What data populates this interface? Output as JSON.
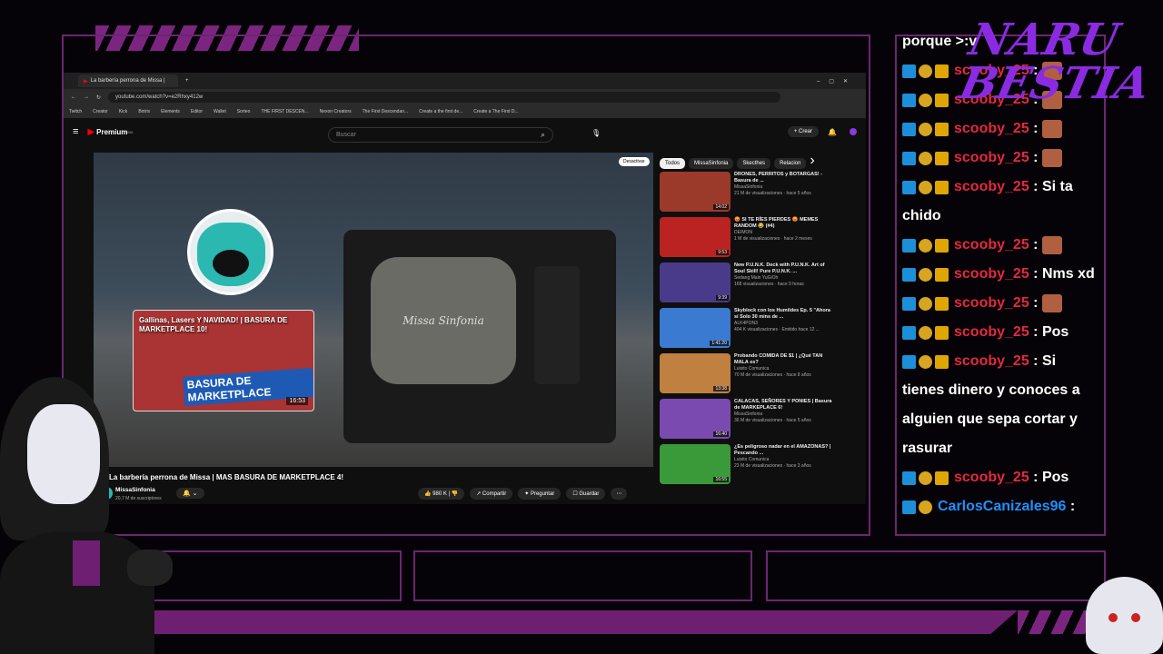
{
  "browser": {
    "tab_title": "La barbería perrona de Missa |",
    "url": "youtube.com/watch?v=e2Rhxy412w",
    "bookmarks": [
      "Twitch",
      "Creator",
      "Kick",
      "Botrix",
      "Elements",
      "Editor",
      "Wallet",
      "Sorteo",
      "THE FIRST DESCEN...",
      "Nexon Creators",
      "The First Descendan...",
      "Create a the first de...",
      "Create a The First D..."
    ]
  },
  "youtube": {
    "brand": "Premium",
    "brand_sup": "MX",
    "search_placeholder": "Buscar",
    "create_label": "+ Crear",
    "video_title": "La barbería perrona de Missa | MAS BASURA DE MARKETPLACE 4!",
    "channel_name": "MissaSinfonia",
    "subscribers": "20,7 M de suscriptores",
    "likes": "980 K",
    "share_label": "Compartir",
    "ask_label": "Preguntar",
    "save_label": "Guardar",
    "ambient_label": "Desactivar",
    "tv_text": "Missa Sinfonia",
    "endcard_title": "Gallinas, Lasers Y NAVIDAD! | BASURA DE MARKETPLACE 10!",
    "endcard_banner": "BASURA DE MARKETPLACE",
    "endcard_duration": "16:53",
    "chips": [
      "Todos",
      "MissaSinfonia",
      "Skecthes",
      "Relacion"
    ],
    "recommendations": [
      {
        "title": "DRONES, PERRITOS y BOTARGAS! - Basura de ...",
        "channel": "MissaSinfonia",
        "meta": "21 M de visualizaciones · hace 5 años",
        "duration": "14:02",
        "color": "#9b3a2a"
      },
      {
        "title": "😡 SI TE RÍES PIERDES 😡 MEMES RANDOM 😂 (#4)",
        "channel": "DEIMON",
        "meta": "1 M de visualizaciones · hace 2 meses",
        "duration": "9:53",
        "color": "#b22"
      },
      {
        "title": "New P.U.N.K. Deck with P.U.N.K. Art of Soul Skill! Pure P.U.N.K. ...",
        "channel": "Sedang Main YuGiOh",
        "meta": "168 visualizaciones · hace 9 horas",
        "duration": "9:39",
        "color": "#4a3a8a"
      },
      {
        "title": "Skyblock con los Humildes Ep. 5 \"Ahora sí Solo 30 mins de ...",
        "channel": "ALK4PON3",
        "meta": "404 K visualizaciones · Emitido hace 12 ...",
        "duration": "1:41:20",
        "color": "#3a7ad0"
      },
      {
        "title": "Probando COMIDA DE $1 | ¿Qué TAN MALA es?",
        "channel": "Luisito Comunica",
        "meta": "70 M de visualizaciones · hace 8 años",
        "duration": "13:38",
        "color": "#c08040"
      },
      {
        "title": "CALACAS, SEÑORES Y PONIES | Basura de MARKEPLACE 6!",
        "channel": "MissaSinfonia",
        "meta": "36 M de visualizaciones · hace 5 años",
        "duration": "16:40",
        "color": "#7a4ab0"
      },
      {
        "title": "¿Es peligroso nadar en el AMAZONAS? | Pescando ...",
        "channel": "Luisito Comunica",
        "meta": "23 M de visualizaciones · hace 3 años",
        "duration": "16:55",
        "color": "#3a9a3a"
      }
    ]
  },
  "chat": {
    "lines": [
      {
        "user": "",
        "text": "porque >:v",
        "badges": 0
      },
      {
        "user": "scooby_25",
        "text": ":",
        "badges": 3,
        "emote": true
      },
      {
        "user": "scooby_25",
        "text": ":",
        "badges": 3,
        "emote": true
      },
      {
        "user": "scooby_25",
        "text": ":",
        "badges": 3,
        "emote": true
      },
      {
        "user": "scooby_25",
        "text": ":",
        "badges": 3,
        "emote": true
      },
      {
        "user": "scooby_25",
        "text": ": Si ta",
        "badges": 3
      },
      {
        "user": "",
        "text": "chido",
        "badges": 0
      },
      {
        "user": "scooby_25",
        "text": ":",
        "badges": 3,
        "emote": true
      },
      {
        "user": "scooby_25",
        "text": ": Nms xd",
        "badges": 3
      },
      {
        "user": "scooby_25",
        "text": ":",
        "badges": 3,
        "emote": true
      },
      {
        "user": "scooby_25",
        "text": ": Pos",
        "badges": 3
      },
      {
        "user": "scooby_25",
        "text": ": Si",
        "badges": 3
      },
      {
        "user": "",
        "text": "tienes dinero y conoces a",
        "badges": 0
      },
      {
        "user": "",
        "text": "alguien que sepa cortar y",
        "badges": 0
      },
      {
        "user": "",
        "text": "rasurar",
        "badges": 0
      },
      {
        "user": "scooby_25",
        "text": ": Pos",
        "badges": 3
      },
      {
        "user": "CarlosCanizales96",
        "text": ":",
        "badges": 2
      }
    ]
  },
  "logo_text": "NARU BESTIA"
}
